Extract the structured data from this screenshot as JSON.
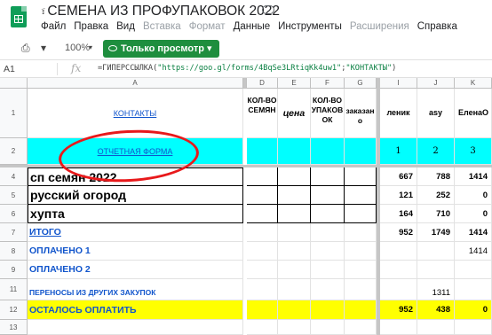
{
  "window": {
    "title_prefix": "፣",
    "title": "СЕМЕНА ИЗ ПРОФУПАКОВОК 2022"
  },
  "menu": [
    "Файл",
    "Правка",
    "Вид",
    "Вставка",
    "Формат",
    "Данные",
    "Инструменты",
    "Расширения",
    "Справка"
  ],
  "toolbar": {
    "zoom": "100%",
    "view_button": "Только просмотр"
  },
  "formula_bar": {
    "cell_ref": "A1",
    "fx": "fx",
    "prefix": "=ГИПЕРССЫЛКА(",
    "url": "\"https://goo.gl/forms/4BqSe3LRtiqKk4uw1\"",
    "sep": ";",
    "label": "\"КОНТАКТЫ\"",
    "suffix": ")"
  },
  "columns": [
    "A",
    "D",
    "E",
    "F",
    "G",
    "I",
    "J",
    "K"
  ],
  "rows": [
    "1",
    "2",
    "4",
    "5",
    "6",
    "7",
    "8",
    "9",
    "11",
    "12",
    "13"
  ],
  "cells": {
    "a1": "КОНТАКТЫ",
    "d1": "КОЛ-ВО СЕМЯН",
    "e1": "цена",
    "f1": "КОЛ-ВО УПАКОВОК",
    "g1": "заказано",
    "i1": "леник",
    "j1": "asy",
    "k1": "ЕленаО",
    "a2": "ОТЧЕТНАЯ ФОРМА",
    "i2": "1",
    "j2": "2",
    "k2": "3",
    "a4": "сп семян 2022",
    "i4": "667",
    "j4": "788",
    "k4": "1414",
    "a5": "русский огород",
    "i5": "121",
    "j5": "252",
    "k5": "0",
    "a6": "хупта",
    "i6": "164",
    "j6": "710",
    "k6": "0",
    "a7": "ИТОГО",
    "i7": "952",
    "j7": "1749",
    "k7": "1414",
    "a8": "ОПЛАЧЕНО 1",
    "k8": "1414",
    "a9": "ОПЛАЧЕНО 2",
    "a11": "ПЕРЕНОСЫ ИЗ ДРУГИХ ЗАКУПОК",
    "j11": "1311",
    "a12": "ОСТАЛОСЬ ОПЛАТИТЬ",
    "i12": "952",
    "j12": "438",
    "k12": "0"
  }
}
